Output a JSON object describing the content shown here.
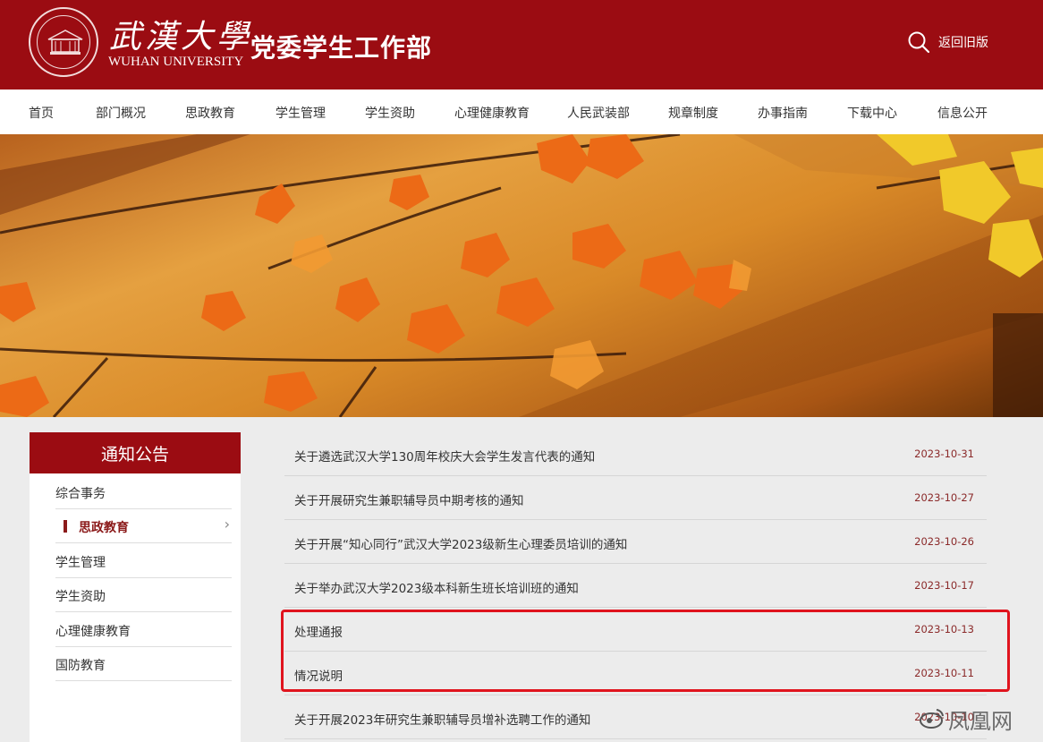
{
  "header": {
    "logo_cn": "武漢大學",
    "logo_en": "WUHAN UNIVERSITY",
    "site_title": "党委学生工作部",
    "old_version_link": "返回旧版",
    "brand_color": "#9b0c12"
  },
  "nav": {
    "items": [
      "首页",
      "部门概况",
      "思政教育",
      "学生管理",
      "学生资助",
      "心理健康教育",
      "人民武装部",
      "规章制度",
      "办事指南",
      "下载中心",
      "信息公开"
    ]
  },
  "sidebar": {
    "title": "通知公告",
    "items": [
      {
        "label": "综合事务",
        "active": false
      },
      {
        "label": "思政教育",
        "active": true
      },
      {
        "label": "学生管理",
        "active": false
      },
      {
        "label": "学生资助",
        "active": false
      },
      {
        "label": "心理健康教育",
        "active": false
      },
      {
        "label": "国防教育",
        "active": false
      }
    ]
  },
  "notices": [
    {
      "title": "关于遴选武汉大学130周年校庆大会学生发言代表的通知",
      "date": "2023-10-31"
    },
    {
      "title": "关于开展研究生兼职辅导员中期考核的通知",
      "date": "2023-10-27"
    },
    {
      "title": "关于开展“知心同行”武汉大学2023级新生心理委员培训的通知",
      "date": "2023-10-26"
    },
    {
      "title": "关于举办武汉大学2023级本科新生班长培训班的通知",
      "date": "2023-10-17"
    },
    {
      "title": "处理通报",
      "date": "2023-10-13"
    },
    {
      "title": "情况说明",
      "date": "2023-10-11"
    },
    {
      "title": "关于开展2023年研究生兼职辅导员增补选聘工作的通知",
      "date": "2023-10-10"
    }
  ],
  "watermark": "凤凰网"
}
